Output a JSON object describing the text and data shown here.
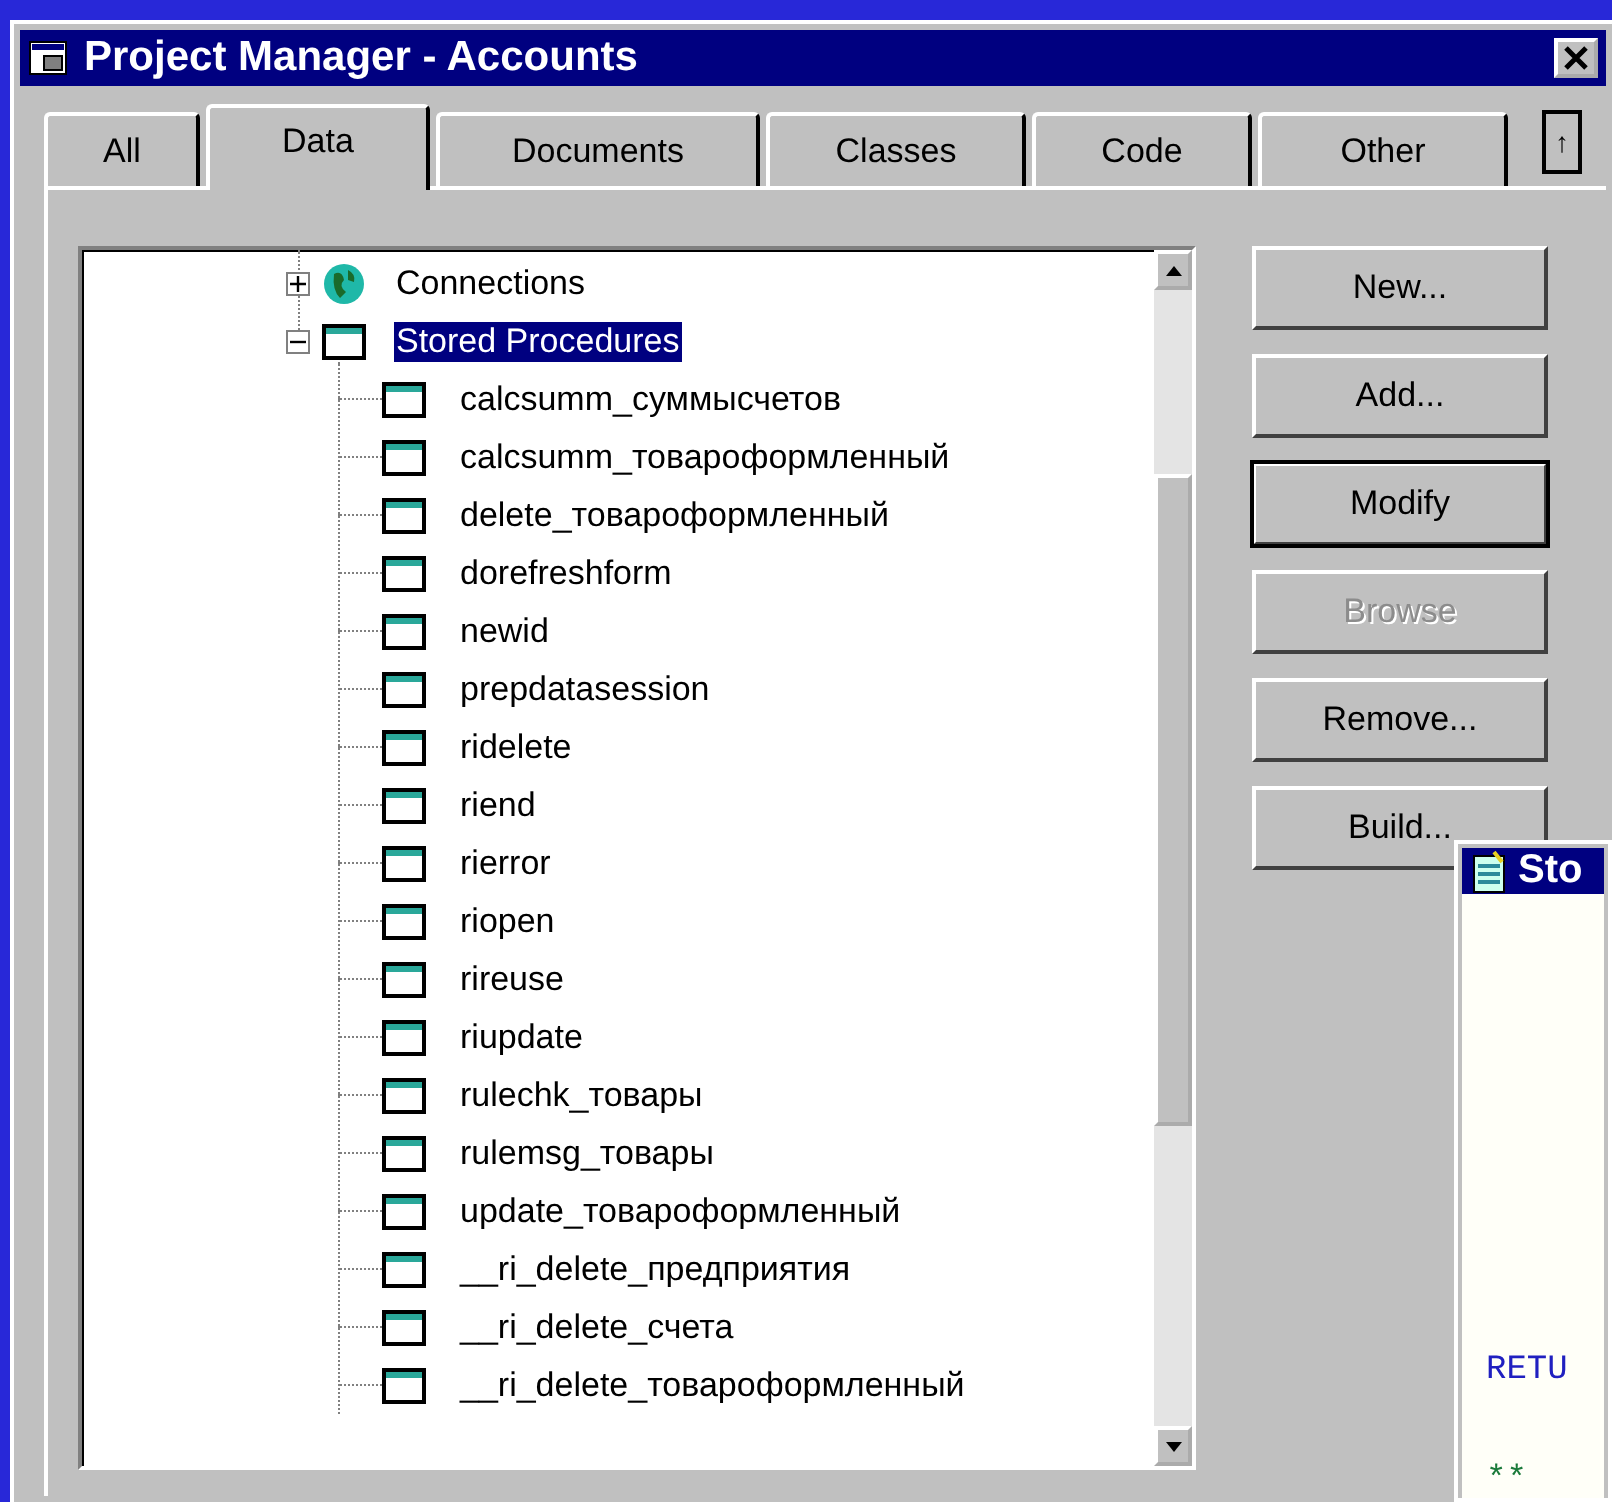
{
  "window": {
    "title": "Project Manager - Accounts"
  },
  "tabs": [
    {
      "label": "All",
      "selected": false
    },
    {
      "label": "Data",
      "selected": true
    },
    {
      "label": "Documents",
      "selected": false
    },
    {
      "label": "Classes",
      "selected": false
    },
    {
      "label": "Code",
      "selected": false
    },
    {
      "label": "Other",
      "selected": false
    }
  ],
  "tab_scroll": {
    "symbol": "↑"
  },
  "tree": {
    "items": [
      {
        "label": "Connections",
        "kind": "globe",
        "expanded": false,
        "selected": false
      },
      {
        "label": "Stored Procedures",
        "kind": "window",
        "expanded": true,
        "selected": true,
        "children": [
          {
            "label": "calcsumm_суммысчетов",
            "selected": false
          },
          {
            "label": "calcsumm_товароформленный",
            "selected": false
          },
          {
            "label": "delete_товароформленный",
            "selected": false
          },
          {
            "label": "dorefreshform",
            "selected": false
          },
          {
            "label": "newid",
            "selected": false
          },
          {
            "label": "prepdatasession",
            "selected": false
          },
          {
            "label": "ridelete",
            "selected": false
          },
          {
            "label": "riend",
            "selected": false
          },
          {
            "label": "rierror",
            "selected": false
          },
          {
            "label": "riopen",
            "selected": false
          },
          {
            "label": "rireuse",
            "selected": false
          },
          {
            "label": "riupdate",
            "selected": false
          },
          {
            "label": "rulechk_товары",
            "selected": false
          },
          {
            "label": "rulemsg_товары",
            "selected": false
          },
          {
            "label": "update_товароформленный",
            "selected": false
          },
          {
            "label": "__ri_delete_предприятия",
            "selected": false
          },
          {
            "label": "__ri_delete_счета",
            "selected": false
          },
          {
            "label": "__ri_delete_товароформленный",
            "selected": false
          }
        ]
      }
    ]
  },
  "buttons": [
    {
      "label": "New...",
      "default": false,
      "disabled": false
    },
    {
      "label": "Add...",
      "default": false,
      "disabled": false
    },
    {
      "label": "Modify",
      "default": true,
      "disabled": false
    },
    {
      "label": "Browse",
      "default": false,
      "disabled": true
    },
    {
      "label": "Remove...",
      "default": false,
      "disabled": false
    },
    {
      "label": "Build...",
      "default": false,
      "disabled": false
    }
  ],
  "editor_window": {
    "title": "Sto",
    "lines": [
      {
        "text": "RETU",
        "kind": "keyword"
      },
      {
        "text": "**",
        "kind": "comment"
      }
    ]
  }
}
